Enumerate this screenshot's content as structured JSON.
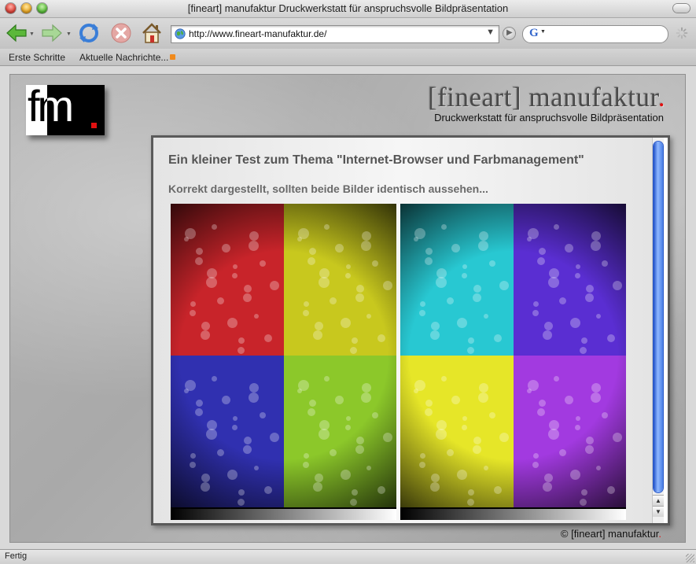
{
  "window": {
    "title": "[fineart] manufaktur Druckwerkstatt für anspruchsvolle Bildpräsentation"
  },
  "toolbar": {
    "url": "http://www.fineart-manufaktur.de/",
    "search_placeholder": ""
  },
  "bookmarks": {
    "items": [
      {
        "label": "Erste Schritte"
      },
      {
        "label": "Aktuelle Nachrichte..."
      }
    ]
  },
  "page": {
    "logo_text": "fm",
    "brand_name": "[fineart] manufaktur",
    "brand_dot": ".",
    "tagline": "Druckwerkstatt für anspruchsvolle Bildpräsentation",
    "heading": "Ein kleiner Test zum Thema \"Internet-Browser und Farbmanagement\"",
    "subheading": "Korrekt dargestellt, sollten beide Bilder identisch aussehen...",
    "copyright": "© [fineart] manufaktur",
    "copyright_dot": "."
  },
  "images": {
    "left_quadrant_colors": [
      "#c8242a",
      "#c8c81e",
      "#3030b0",
      "#8cc82a"
    ],
    "right_quadrant_colors": [
      "#28c8d2",
      "#5a2ed2",
      "#e6e628",
      "#a23ae0"
    ]
  },
  "status": {
    "text": "Fertig"
  }
}
